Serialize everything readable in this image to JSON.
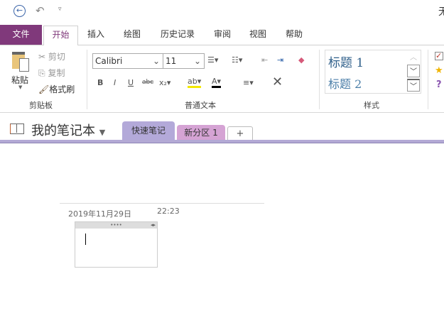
{
  "title_bar": {
    "title_partial": "无"
  },
  "ribbon_tabs": [
    {
      "label": "文件"
    },
    {
      "label": "开始"
    },
    {
      "label": "插入"
    },
    {
      "label": "绘图"
    },
    {
      "label": "历史记录"
    },
    {
      "label": "审阅"
    },
    {
      "label": "视图"
    },
    {
      "label": "帮助"
    }
  ],
  "clipboard": {
    "paste": "粘贴",
    "cut": "剪切",
    "copy": "复制",
    "format_painter": "格式刷",
    "group": "剪贴板"
  },
  "text": {
    "font": "Calibri",
    "size": "11",
    "group": "普通文本"
  },
  "styles": {
    "h1": "标题 1",
    "h2": "标题 2",
    "group": "样式"
  },
  "notebook": {
    "name": "我的笔记本",
    "sections": [
      {
        "label": "快速笔记",
        "color": "#b3a9d9"
      },
      {
        "label": "新分区 1",
        "color": "#d5a3d4"
      }
    ],
    "add": "+"
  },
  "page": {
    "date": "2019年11月29日",
    "time": "22:23"
  },
  "colors": {
    "file_tab": "#80397b",
    "accent_line": "#b3a9d5"
  }
}
